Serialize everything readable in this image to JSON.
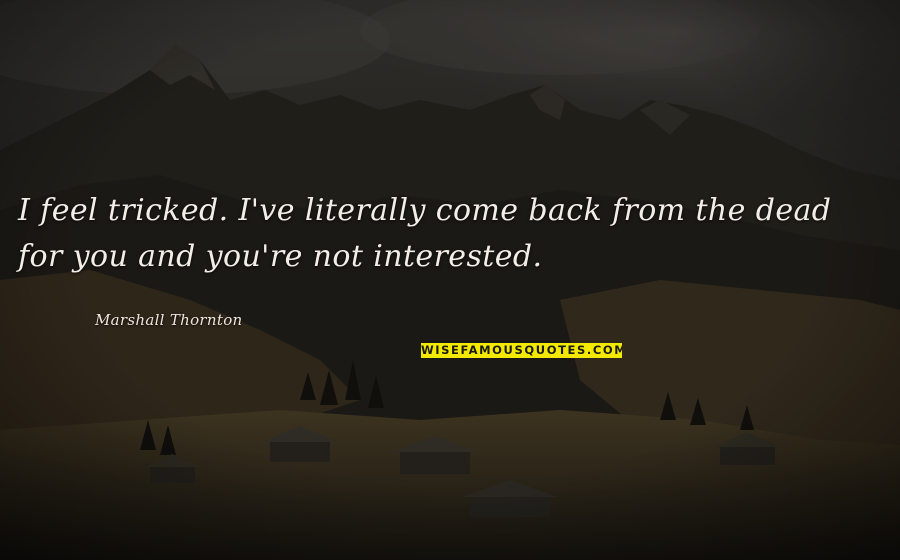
{
  "quote": {
    "line1": "I feel tricked. I've literally come back from the dead",
    "line2": "for you and you're not interested."
  },
  "author": "Marshall Thornton",
  "watermark": "WISEFAMOUSQUOTES.COM",
  "colors": {
    "quote_text": "#f2ede6",
    "watermark_bg": "#f4ea00",
    "sky": "#2c2a27",
    "mountains": "#1f1d1a",
    "meadow": "#3d3421"
  }
}
